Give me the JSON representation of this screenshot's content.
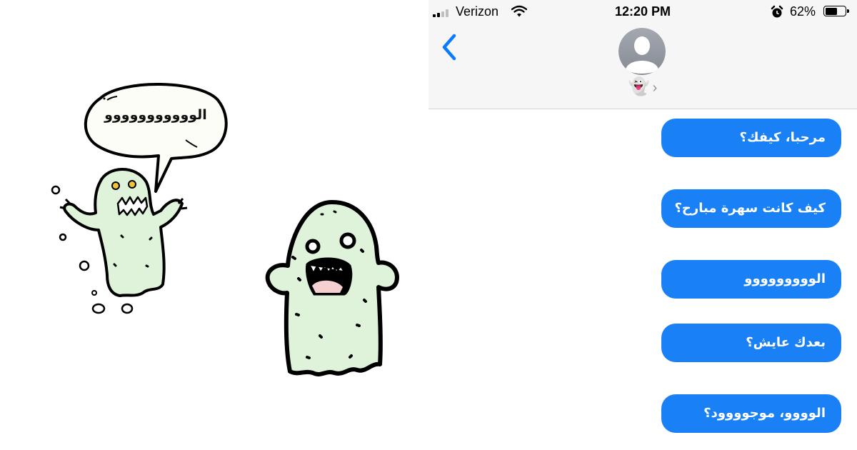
{
  "illustration": {
    "speech_bubble_text": "الووووووووووو",
    "colors": {
      "ghost_fill": "#dff3db",
      "outline": "#000000",
      "eye_yellow": "#f2c431",
      "mouth_pink": "#f6d0d0"
    }
  },
  "status_bar": {
    "carrier": "Verizon",
    "time": "12:20 PM",
    "battery_percent": "62%",
    "battery_level": 0.62,
    "icons": [
      "signal-icon",
      "wifi-icon",
      "alarm-icon",
      "battery-icon"
    ]
  },
  "nav": {
    "back_icon": "chevron-left-icon",
    "avatar_icon": "person-placeholder-icon",
    "contact_name": "👻",
    "contact_chevron": "›"
  },
  "messages": [
    {
      "text": "مرحبا، كيفك؟"
    },
    {
      "text": "كيف كانت سهرة مبارح؟"
    },
    {
      "text": "الووووووووو"
    },
    {
      "text": "بعدك عايش؟"
    },
    {
      "text": "الوووو، موجوووود؟"
    }
  ],
  "colors": {
    "bubble_blue": "#1a80f5",
    "header_bg": "#f6f6f7",
    "ios_blue": "#0a7aff"
  }
}
